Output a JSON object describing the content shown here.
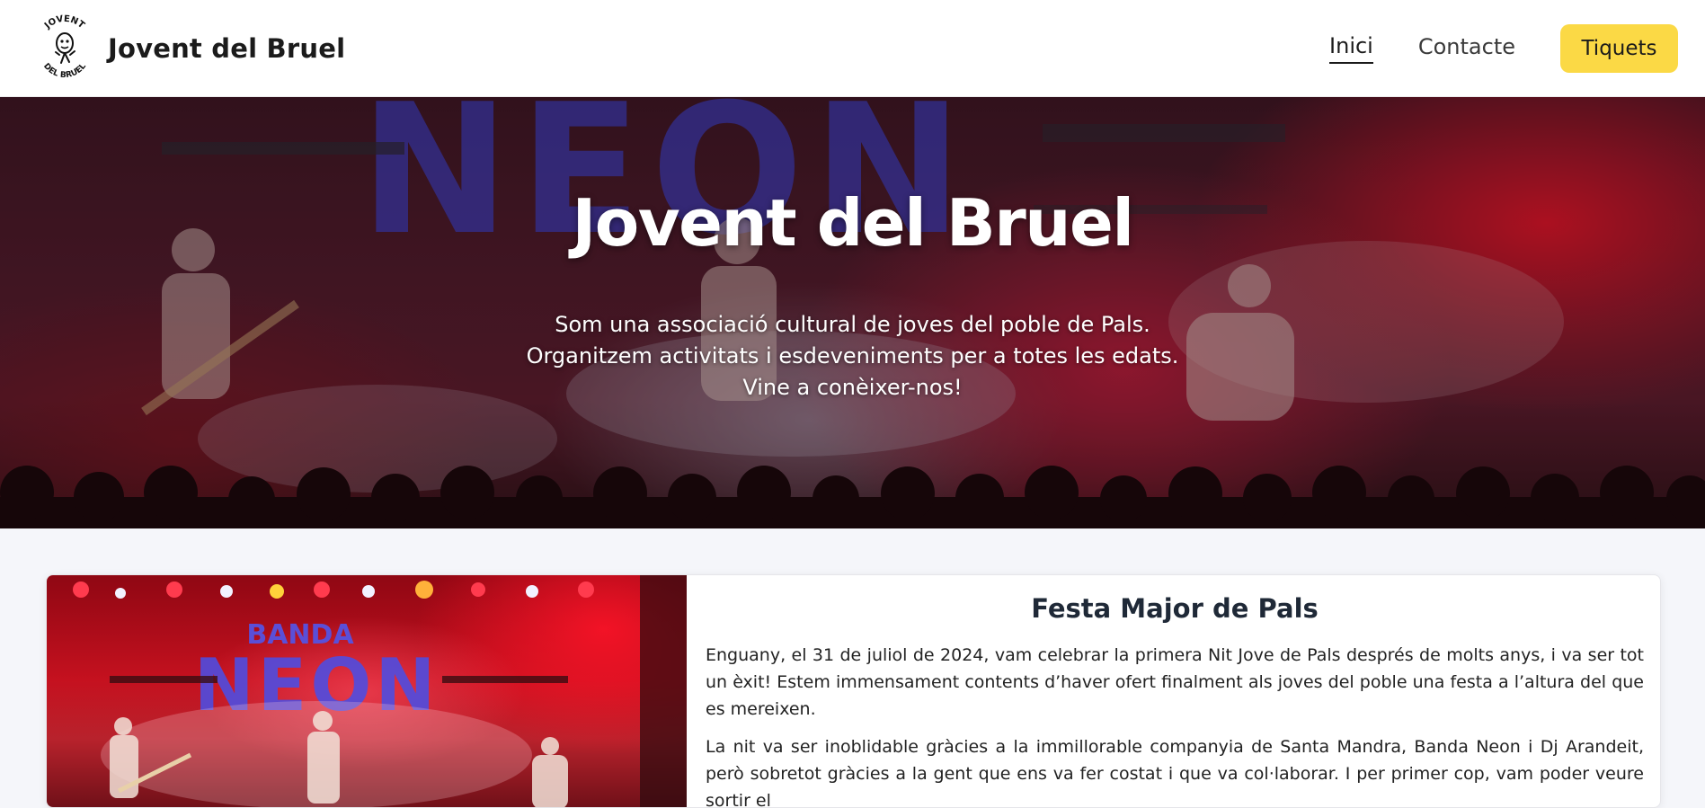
{
  "brand": {
    "name": "Jovent del Bruel",
    "logo_top": "JOVENT",
    "logo_bottom": "DEL BRUEL"
  },
  "nav": {
    "links": [
      {
        "label": "Inici",
        "active": true
      },
      {
        "label": "Contacte",
        "active": false
      }
    ],
    "cta_label": "Tiquets",
    "cta_color": "#fbd945"
  },
  "hero": {
    "title": "Jovent del Bruel",
    "lines": [
      "Som una associació cultural de joves del poble de Pals.",
      "Organitzem activitats i esdeveniments per a totes les edats.",
      "Vine a conèixer-nos!"
    ],
    "backdrop_text": "NEON"
  },
  "card": {
    "image_text_top": "BANDA",
    "image_text_main": "NEON",
    "title": "Festa Major de Pals",
    "paragraphs": [
      "Enguany, el 31 de juliol de 2024, vam celebrar la primera Nit Jove de Pals després de molts anys, i va ser tot un èxit! Estem immensament contents d’haver ofert finalment als joves del poble una festa a l’altura del que es mereixen.",
      "La nit va ser inoblidable gràcies a la immillorable companyia de Santa Mandra, Banda Neon i Dj Arandeit, però sobretot gràcies a la gent que ens va fer costat i que va col·laborar. I per primer cop, vam poder veure sortir el"
    ]
  }
}
